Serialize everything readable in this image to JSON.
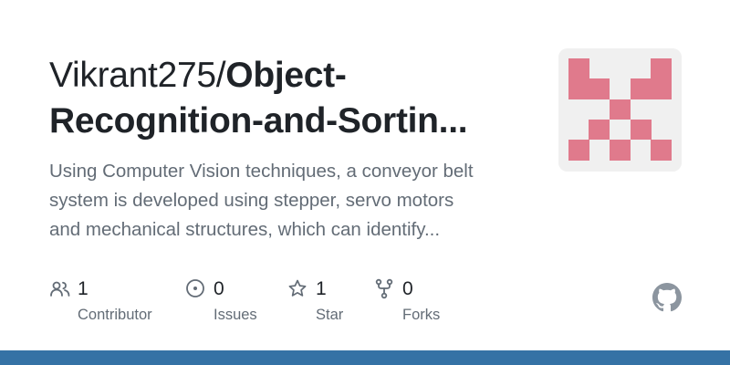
{
  "repo": {
    "owner": "Vikrant275/",
    "name_line1": "Object-",
    "name_line2": "Recognition-and-Sortin..."
  },
  "description": {
    "line1": "Using Computer Vision techniques, a conveyor belt",
    "line2": "system is developed using stepper, servo motors",
    "line3": "and mechanical structures, which can identify..."
  },
  "stats": {
    "contributors": {
      "count": "1",
      "label": "Contributor",
      "icon": "people-icon"
    },
    "issues": {
      "count": "0",
      "label": "Issues",
      "icon": "issue-circle-icon"
    },
    "stars": {
      "count": "1",
      "label": "Star",
      "icon": "star-icon"
    },
    "forks": {
      "count": "0",
      "label": "Forks",
      "icon": "fork-icon"
    }
  },
  "colors": {
    "avatar_pattern": "#e07a8c",
    "avatar_background": "#f0f0f0",
    "language_bar": "#3572a5",
    "text_primary": "#1f2328",
    "text_secondary": "#636c76"
  },
  "logo": "github-mark-icon"
}
